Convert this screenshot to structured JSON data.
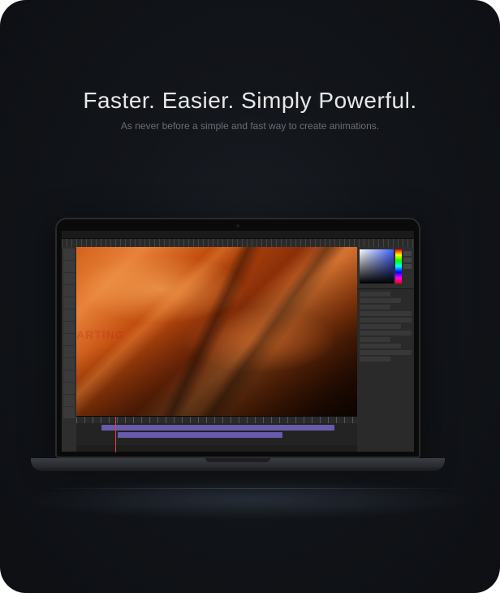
{
  "hero": {
    "headline": "Faster. Easier. Simply Powerful.",
    "subhead": "As never before a simple and fast way to create animations."
  },
  "app": {
    "watermark": "ARTING"
  }
}
